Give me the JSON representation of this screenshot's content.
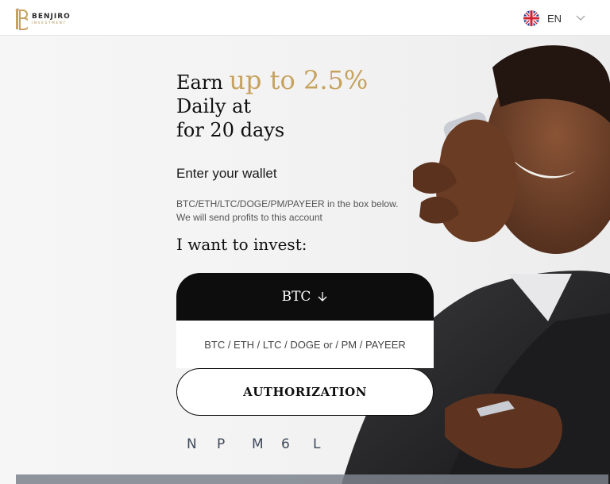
{
  "header": {
    "logo_name": "BENJIRO",
    "logo_sub": "INVESTMENT",
    "language_code": "EN",
    "language_flag": "uk-flag-icon"
  },
  "hero": {
    "earn": "Earn",
    "rate": "up to 2.5%",
    "daily": "Daily at",
    "duration": "for 20 days"
  },
  "wallet": {
    "title": "Enter your wallet",
    "desc_line1": "BTC/ETH/LTC/DOGE/PM/PAYEER in the box below.",
    "desc_line2": "We will send profits to this account"
  },
  "invest": {
    "title": "I want to invest:",
    "currency": "BTC",
    "input_placeholder": "BTC / ETH / LTC / DOGE or / PM / PAYEER",
    "button_label": "AUTHORIZATION"
  },
  "captcha": [
    "N",
    "P",
    "M",
    "6",
    "L"
  ],
  "colors": {
    "accent": "#c6a25e",
    "dark": "#0d0d0d",
    "background": "#f6f6f6"
  }
}
